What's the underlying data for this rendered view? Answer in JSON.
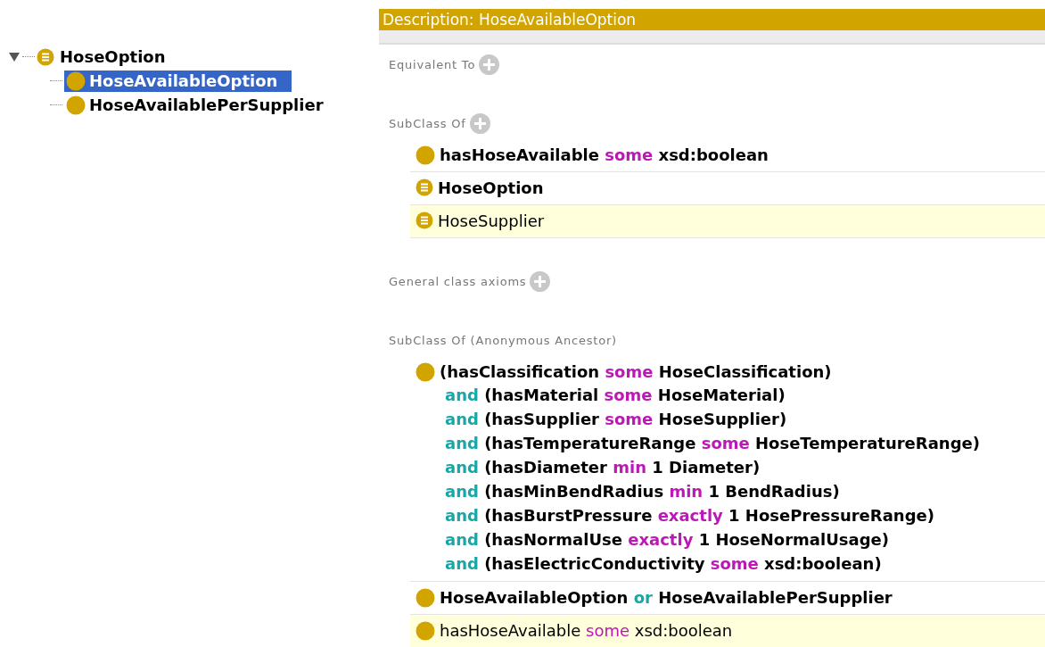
{
  "tree": {
    "label": "HoseOption",
    "kind": "class",
    "expanded": true,
    "children": [
      {
        "label": "HoseAvailableOption",
        "kind": "defined",
        "selected": true
      },
      {
        "label": "HoseAvailablePerSupplier",
        "kind": "defined",
        "selected": false
      }
    ]
  },
  "description": {
    "title": "Description: HoseAvailableOption",
    "sections": [
      {
        "label": "Equivalent To",
        "addable": true
      },
      {
        "label": "SubClass Of",
        "addable": true,
        "items": [
          {
            "kind": "defined",
            "inferred": false,
            "lines": [
              [
                {
                  "text": "hasHoseAvailable",
                  "kind": "entity"
                },
                {
                  "text": "some",
                  "kind": "keyword"
                },
                {
                  "text": "xsd:boolean",
                  "kind": "entity"
                }
              ]
            ]
          },
          {
            "kind": "class",
            "inferred": false,
            "lines": [
              [
                {
                  "text": "HoseOption",
                  "kind": "entity"
                }
              ]
            ]
          },
          {
            "kind": "class",
            "inferred": true,
            "lines": [
              [
                {
                  "text": "HoseSupplier",
                  "kind": "entity"
                }
              ]
            ]
          }
        ]
      },
      {
        "label": "General class axioms",
        "addable": true
      },
      {
        "label": "SubClass Of (Anonymous Ancestor)",
        "addable": false,
        "items": [
          {
            "kind": "defined",
            "inferred": false,
            "lines": [
              [
                {
                  "text": "(hasClassification",
                  "kind": "entity"
                },
                {
                  "text": "some",
                  "kind": "keyword"
                },
                {
                  "text": "HoseClassification)",
                  "kind": "entity"
                }
              ],
              [
                {
                  "text": "and",
                  "kind": "connective"
                },
                {
                  "text": "(hasMaterial",
                  "kind": "entity"
                },
                {
                  "text": "some",
                  "kind": "keyword"
                },
                {
                  "text": "HoseMaterial)",
                  "kind": "entity"
                }
              ],
              [
                {
                  "text": "and",
                  "kind": "connective"
                },
                {
                  "text": "(hasSupplier",
                  "kind": "entity"
                },
                {
                  "text": "some",
                  "kind": "keyword"
                },
                {
                  "text": "HoseSupplier)",
                  "kind": "entity"
                }
              ],
              [
                {
                  "text": "and",
                  "kind": "connective"
                },
                {
                  "text": "(hasTemperatureRange",
                  "kind": "entity"
                },
                {
                  "text": "some",
                  "kind": "keyword"
                },
                {
                  "text": "HoseTemperatureRange)",
                  "kind": "entity"
                }
              ],
              [
                {
                  "text": "and",
                  "kind": "connective"
                },
                {
                  "text": "(hasDiameter",
                  "kind": "entity"
                },
                {
                  "text": "min",
                  "kind": "keyword"
                },
                {
                  "text": "1",
                  "kind": "entity"
                },
                {
                  "text": "Diameter)",
                  "kind": "entity"
                }
              ],
              [
                {
                  "text": "and",
                  "kind": "connective"
                },
                {
                  "text": "(hasMinBendRadius",
                  "kind": "entity"
                },
                {
                  "text": "min",
                  "kind": "keyword"
                },
                {
                  "text": "1",
                  "kind": "entity"
                },
                {
                  "text": "BendRadius)",
                  "kind": "entity"
                }
              ],
              [
                {
                  "text": "and",
                  "kind": "connective"
                },
                {
                  "text": "(hasBurstPressure",
                  "kind": "entity"
                },
                {
                  "text": "exactly",
                  "kind": "keyword"
                },
                {
                  "text": "1",
                  "kind": "entity"
                },
                {
                  "text": "HosePressureRange)",
                  "kind": "entity"
                }
              ],
              [
                {
                  "text": "and",
                  "kind": "connective"
                },
                {
                  "text": "(hasNormalUse",
                  "kind": "entity"
                },
                {
                  "text": "exactly",
                  "kind": "keyword"
                },
                {
                  "text": "1",
                  "kind": "entity"
                },
                {
                  "text": "HoseNormalUsage)",
                  "kind": "entity"
                }
              ],
              [
                {
                  "text": "and",
                  "kind": "connective"
                },
                {
                  "text": "(hasElectricConductivity",
                  "kind": "entity"
                },
                {
                  "text": "some",
                  "kind": "keyword"
                },
                {
                  "text": "xsd:boolean)",
                  "kind": "entity"
                }
              ]
            ]
          },
          {
            "kind": "defined",
            "inferred": false,
            "lines": [
              [
                {
                  "text": "HoseAvailableOption",
                  "kind": "entity"
                },
                {
                  "text": "or",
                  "kind": "connective"
                },
                {
                  "text": "HoseAvailablePerSupplier",
                  "kind": "entity"
                }
              ]
            ]
          },
          {
            "kind": "defined",
            "inferred": true,
            "lines": [
              [
                {
                  "text": "hasHoseAvailable",
                  "kind": "entity"
                },
                {
                  "text": "some",
                  "kind": "keyword"
                },
                {
                  "text": "xsd:boolean",
                  "kind": "entity"
                }
              ]
            ]
          }
        ]
      }
    ]
  }
}
